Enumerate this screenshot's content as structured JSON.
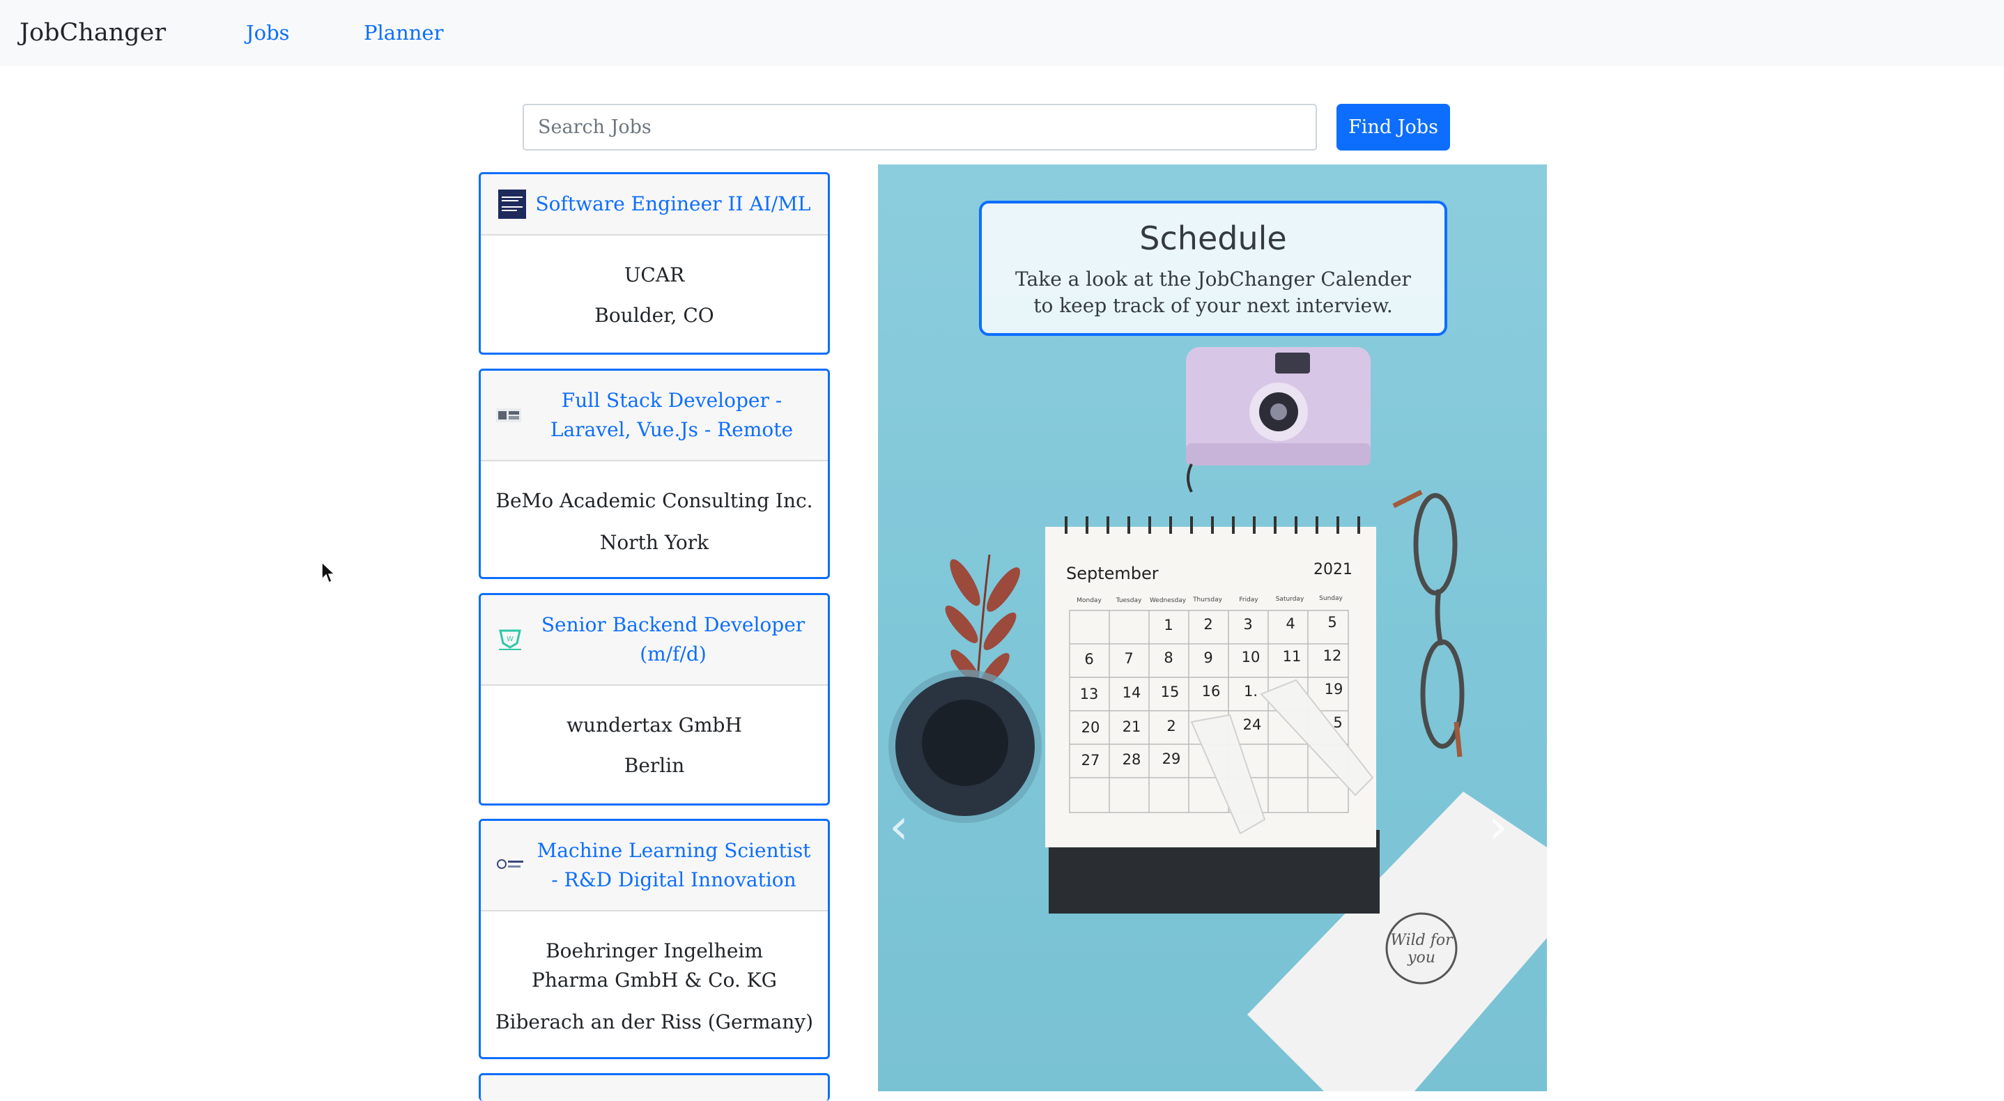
{
  "navbar": {
    "brand": "JobChanger",
    "links": [
      "Jobs",
      "Planner"
    ]
  },
  "search": {
    "placeholder": "Search Jobs",
    "value": "",
    "button_label": "Find Jobs"
  },
  "jobs": [
    {
      "title": "Software Engineer II AI/ML",
      "company": "UCAR",
      "location": "Boulder, CO",
      "logo": "ucar-logo"
    },
    {
      "title": "Full Stack Developer - Laravel, Vue.Js - Remote",
      "company": "BeMo Academic Consulting Inc.",
      "location": "North York",
      "logo": "bemo-logo"
    },
    {
      "title": "Senior Backend Developer (m/f/d)",
      "company": "wundertax GmbH",
      "location": "Berlin",
      "logo": "wundertax-logo"
    },
    {
      "title": "Machine Learning Scientist - R&D Digital Innovation",
      "company": "Boehringer Ingelheim Pharma GmbH & Co. KG",
      "location": "Biberach an der Riss (Germany)",
      "logo": "boehringer-logo"
    }
  ],
  "carousel": {
    "caption_title": "Schedule",
    "caption_text": "Take a look at the JobChanger Calender to keep track of your next interview.",
    "image_month": "September",
    "image_year": "2021",
    "image_weekdays": [
      "Monday",
      "Tuesday",
      "Wednesday",
      "Thursday",
      "Friday",
      "Saturday",
      "Sunday"
    ],
    "image_days": [
      "1",
      "2",
      "3",
      "4",
      "5",
      "6",
      "7",
      "8",
      "9",
      "10",
      "11",
      "12",
      "13",
      "14",
      "15",
      "16",
      "1.",
      "19",
      "20",
      "21",
      "2",
      "24",
      "5",
      "27",
      "28",
      "29"
    ],
    "prev_icon": "chevron-left-icon",
    "next_icon": "chevron-right-icon"
  },
  "colors": {
    "primary": "#0d6efd",
    "navbar_bg": "#f8f9fa",
    "carousel_bg": "#86c9da"
  }
}
